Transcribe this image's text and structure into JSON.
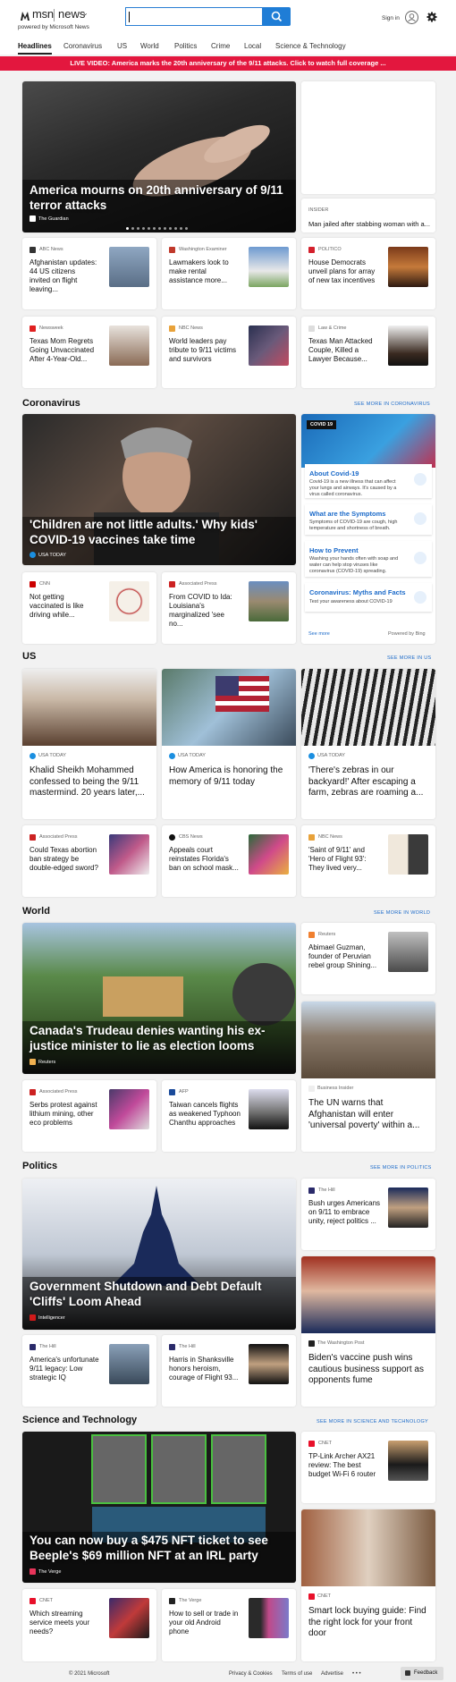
{
  "header": {
    "brand": "msn",
    "product": "news",
    "powered": "powered by Microsoft News",
    "signin": "Sign in"
  },
  "nav": {
    "items": [
      "Headlines",
      "Coronavirus",
      "US",
      "World",
      "Politics",
      "Crime",
      "Local",
      "Science & Technology"
    ]
  },
  "banner": {
    "text": "LIVE VIDEO: America marks the 20th anniversary of the 9/11 attacks. Click to watch full coverage ..."
  },
  "headlines": {
    "hero": {
      "title": "America mourns on 20th anniversary of 9/11 terror attacks",
      "source": "The Guardian"
    },
    "side": {
      "source": "INSIDER",
      "title": "Man jailed after stabbing woman with a..."
    },
    "cards": [
      {
        "source": "ABC News",
        "title": "Afghanistan updates: 44 US citizens invited on flight leaving..."
      },
      {
        "source": "Washington Examiner",
        "title": "Lawmakers look to make rental assistance more..."
      },
      {
        "source": "POLITICO",
        "title": "House Democrats unveil plans for array of new tax incentives"
      },
      {
        "source": "Newsweek",
        "title": "Texas Mom Regrets Going Unvaccinated After 4-Year-Old..."
      },
      {
        "source": "NBC News",
        "title": "World leaders pay tribute to 9/11 victims and survivors"
      },
      {
        "source": "Law & Crime",
        "title": "Texas Man Attacked Couple, Killed a Lawyer Because..."
      }
    ]
  },
  "coronavirus": {
    "section": "Coronavirus",
    "see_more": "SEE MORE IN CORONAVIRUS",
    "hero": {
      "title": "'Children are not little adults.' Why kids' COVID-19 vaccines take time",
      "source": "USA TODAY"
    },
    "cards": [
      {
        "source": "CNN",
        "title": "Not getting vaccinated is like driving while..."
      },
      {
        "source": "Associated Press",
        "title": "From COVID to Ida: Louisiana's marginalized 'see no..."
      }
    ],
    "panel": {
      "badge": "COVID 19",
      "items": [
        {
          "title": "About Covid-19",
          "desc": "Covid-19 is a new illness that can affect your lungs and airways. It's caused by a virus called coronavirus."
        },
        {
          "title": "What are the Symptoms",
          "desc": "Symptoms of COVID-19 are cough, high temperature and shortness of breath."
        },
        {
          "title": "How to Prevent",
          "desc": "Washing your hands often with soap and water can help stop viruses like coronavirus (COVID-19) spreading."
        },
        {
          "title": "Coronavirus: Myths and Facts",
          "desc": "Test your awareness about COVID-19"
        }
      ],
      "see_more": "See more",
      "powered": "Powered by Bing"
    }
  },
  "us": {
    "section": "US",
    "see_more": "SEE MORE IN US",
    "big": [
      {
        "source": "USA TODAY",
        "title": "Khalid Sheikh Mohammed confessed to being the 9/11 mastermind. 20 years later,..."
      },
      {
        "source": "USA TODAY",
        "title": "How America is honoring the memory of 9/11 today"
      },
      {
        "source": "USA TODAY",
        "title": "'There's zebras in our backyard!' After escaping a farm, zebras are roaming a..."
      }
    ],
    "cards": [
      {
        "source": "Associated Press",
        "title": "Could Texas abortion ban strategy be double-edged sword?"
      },
      {
        "source": "CBS News",
        "title": "Appeals court reinstates Florida's ban on school mask..."
      },
      {
        "source": "NBC News",
        "title": "'Saint of 9/11' and 'Hero of Flight 93': They lived very..."
      }
    ]
  },
  "world": {
    "section": "World",
    "see_more": "SEE MORE IN WORLD",
    "hero": {
      "title": "Canada's Trudeau denies wanting his ex-justice minister to lie as election looms",
      "source": "Reuters"
    },
    "side": {
      "source": "Reuters",
      "title": "Abimael Guzman, founder of Peruvian rebel group Shining..."
    },
    "side2": {
      "source": "Business Insider",
      "title": "The UN warns that Afghanistan will enter 'universal poverty' within a..."
    },
    "cards": [
      {
        "source": "Associated Press",
        "title": "Serbs protest against lithium mining, other eco problems"
      },
      {
        "source": "AFP",
        "title": "Taiwan cancels flights as weakened Typhoon Chanthu approaches"
      }
    ]
  },
  "politics": {
    "section": "Politics",
    "see_more": "SEE MORE IN POLITICS",
    "hero": {
      "title": "Government Shutdown and Debt Default 'Cliffs' Loom Ahead",
      "source": "Intelligencer"
    },
    "side": {
      "source": "The Hill",
      "title": "Bush urges Americans on 9/11 to embrace unity, reject politics ..."
    },
    "side2": {
      "source": "The Washington Post",
      "title": "Biden's vaccine push wins cautious business support as opponents fume"
    },
    "cards": [
      {
        "source": "The Hill",
        "title": "America's unfortunate 9/11 legacy: Low strategic IQ"
      },
      {
        "source": "The Hill",
        "title": "Harris in Shanksville honors heroism, courage of Flight 93..."
      }
    ]
  },
  "scitech": {
    "section": "Science and Technology",
    "see_more": "SEE MORE IN SCIENCE AND TECHNOLOGY",
    "hero": {
      "title": "You can now buy a $475 NFT ticket to see Beeple's $69 million NFT at an IRL party",
      "source": "The Verge"
    },
    "side": {
      "source": "CNET",
      "title": "TP-Link Archer AX21 review: The best budget Wi-Fi 6 router"
    },
    "side2": {
      "source": "CNET",
      "title": "Smart lock buying guide: Find the right lock for your front door"
    },
    "cards": [
      {
        "source": "CNET",
        "title": "Which streaming service meets your needs?"
      },
      {
        "source": "The Verge",
        "title": "How to sell or trade in your old Android phone"
      }
    ]
  },
  "footer": {
    "copyright": "© 2021 Microsoft",
    "privacy": "Privacy & Cookies",
    "terms": "Terms of use",
    "advertise": "Advertise",
    "more": "• • •",
    "feedback": "Feedback"
  }
}
